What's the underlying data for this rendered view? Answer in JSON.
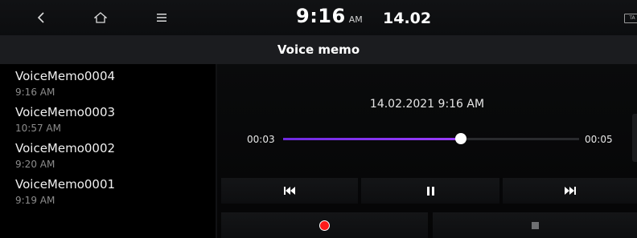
{
  "status_bar": {
    "time": "9:16",
    "ampm": "AM",
    "date": "14.02",
    "ta_badge": "TA"
  },
  "header": {
    "title": "Voice memo"
  },
  "memos": [
    {
      "name": "VoiceMemo0004",
      "time": "9:16 AM"
    },
    {
      "name": "VoiceMemo0003",
      "time": "10:57 AM"
    },
    {
      "name": "VoiceMemo0002",
      "time": "9:20 AM"
    },
    {
      "name": "VoiceMemo0001",
      "time": "9:19 AM"
    }
  ],
  "player": {
    "recorded_at": "14.02.2021 9:16 AM",
    "elapsed": "00:03",
    "duration": "00:05",
    "progress_fraction": 0.6,
    "accent_color": "#9b3dff",
    "record_color": "#ff1a1a"
  },
  "controls": {
    "back_icon": "back-arrow-icon",
    "home_icon": "home-icon",
    "menu_icon": "menu-icon",
    "prev_icon": "skip-previous-icon",
    "pause_icon": "pause-icon",
    "next_icon": "skip-next-icon",
    "record_icon": "record-icon",
    "stop_icon": "stop-icon"
  }
}
